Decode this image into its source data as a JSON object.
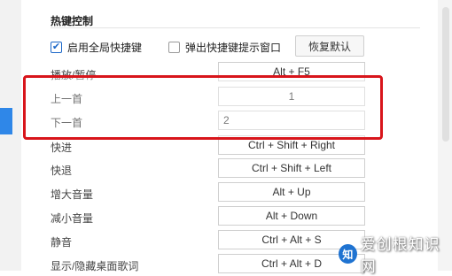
{
  "section": {
    "title": "热键控制"
  },
  "options": {
    "enable_global": {
      "label": "启用全局快捷键",
      "checked": true
    },
    "popup_hint": {
      "label": "弹出快捷键提示窗口",
      "checked": false
    },
    "reset_label": "恢复默认"
  },
  "hotkeys": [
    {
      "label": "播放/暂停",
      "key": "Alt + F5"
    },
    {
      "label": "上一首",
      "key": "1"
    },
    {
      "label": "下一首",
      "key": "2"
    },
    {
      "label": "快进",
      "key": "Ctrl + Shift + Right"
    },
    {
      "label": "快退",
      "key": "Ctrl + Shift + Left"
    },
    {
      "label": "增大音量",
      "key": "Alt + Up"
    },
    {
      "label": "减小音量",
      "key": "Alt + Down"
    },
    {
      "label": "静音",
      "key": "Ctrl + Alt + S"
    },
    {
      "label": "显示/隐藏桌面歌词",
      "key": "Ctrl + Alt + D"
    }
  ],
  "watermark": {
    "text": "爱创根知识网"
  },
  "colors": {
    "accent": "#2f87e8",
    "highlight": "#d8151b",
    "check": "#1a66c8"
  }
}
